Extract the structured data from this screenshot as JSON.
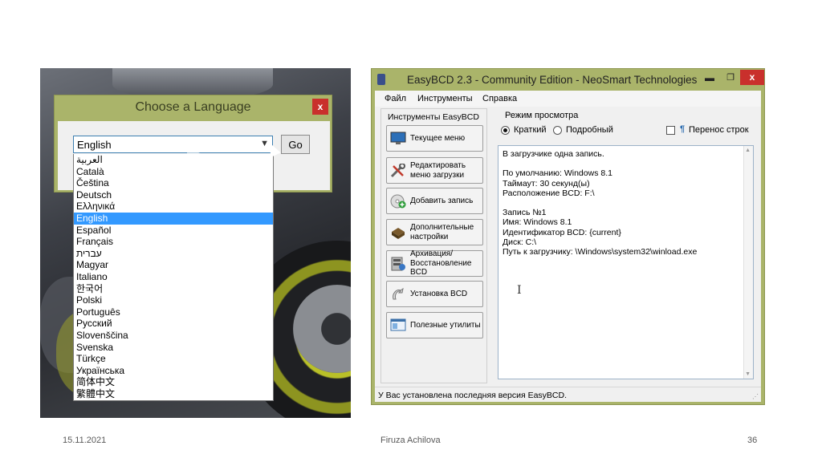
{
  "language_dialog": {
    "title": "Choose a Language",
    "close_label": "x",
    "selected_value": "English",
    "go_label": "Go",
    "languages": [
      "العربية",
      "Català",
      "Čeština",
      "Deutsch",
      "Ελληνικά",
      "English",
      "Español",
      "Français",
      "עברית",
      "Magyar",
      "Italiano",
      "한국어",
      "Polski",
      "Português",
      "Русский",
      "Slovenščina",
      "Svenska",
      "Türkçe",
      "Українська",
      "简体中文",
      "繁體中文"
    ],
    "selected_index": 5
  },
  "easybcd": {
    "title": "EasyBCD 2.3 - Community Edition - NeoSmart Technologies",
    "min_label": "▬",
    "max_label": "❐",
    "close_label": "x",
    "menu": [
      "Файл",
      "Инструменты",
      "Справка"
    ],
    "tools_label": "Инструменты EasyBCD",
    "tools": [
      {
        "label": "Текущее меню",
        "icon": "monitor-icon"
      },
      {
        "label": "Редактировать меню загрузки",
        "icon": "tools-icon"
      },
      {
        "label": "Добавить запись",
        "icon": "add-disc-icon"
      },
      {
        "label": "Дополнительные настройки",
        "icon": "settings-icon"
      },
      {
        "label": "Архивация/Восстановление BCD",
        "icon": "backup-icon"
      },
      {
        "label": "Установка BCD",
        "icon": "install-icon"
      },
      {
        "label": "Полезные утилиты",
        "icon": "utilities-icon"
      }
    ],
    "view_mode_label": "Режим просмотра",
    "view_options": [
      "Краткий",
      "Подробный"
    ],
    "view_selected": "Краткий",
    "wrap_label": "Перенос строк",
    "wrap_checked": false,
    "output_lines": [
      "В загрузчике одна запись.",
      "",
      "По умолчанию: Windows 8.1",
      "Таймаут: 30 секунд(ы)",
      "Расположение BCD: F:\\",
      "",
      "Запись №1",
      "Имя: Windows 8.1",
      "Идентификатор BCD: {current}",
      "Диск: C:\\",
      "Путь к загрузчику: \\Windows\\system32\\winload.exe"
    ],
    "status": "У Вас установлена последняя версия EasyBCD."
  },
  "footer": {
    "date": "15.11.2021",
    "author": "Firuza Achilova",
    "page": "36"
  }
}
